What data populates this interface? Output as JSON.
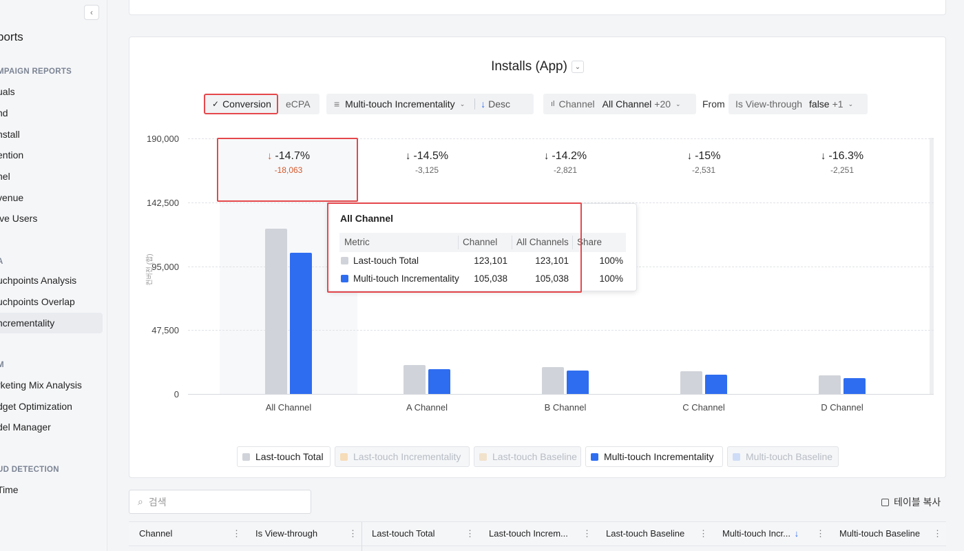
{
  "sidebar": {
    "collapse_icon": "‹",
    "title": "ports",
    "section1": "MPAIGN REPORTS",
    "items1": [
      "uals",
      "nd",
      "nstall",
      "ention",
      "nel",
      "venue",
      "ive Users"
    ],
    "section2": "A",
    "items2": [
      "uchpoints Analysis",
      "uchpoints Overlap",
      "ncrementality"
    ],
    "section3": "M",
    "items3": [
      "rketing Mix Analysis",
      "dget Optimization",
      "del Manager"
    ],
    "section4": "UD DETECTION",
    "items4": [
      "Time"
    ]
  },
  "chart": {
    "title": "Installs (App)",
    "title_dd_icon": "⌄",
    "seg_conversion": "Conversion",
    "seg_check": "✓",
    "seg_ecpa": "eCPA",
    "sort_icon": "≡",
    "sort_label": "Multi-touch Incrementality",
    "sort_arrow": "↓",
    "sort_desc": "Desc",
    "chevron": "⌄",
    "channel_icon": "ıl",
    "channel_label": "Channel",
    "channel_value": "All Channel",
    "channel_more": "+20",
    "from_label": "From",
    "ivt_label": "Is View-through",
    "ivt_value": "false",
    "ivt_more": "+1",
    "y_axis_label": "컨버전 (합)",
    "y_ticks": [
      "190,000",
      "142,500",
      "95,000",
      "47,500",
      "0"
    ]
  },
  "chart_data": {
    "type": "bar",
    "categories": [
      "All Channel",
      "A Channel",
      "B Channel",
      "C Channel",
      "D Channel"
    ],
    "series": [
      {
        "name": "Last-touch Total",
        "values": [
          123101,
          21500,
          20000,
          16800,
          14000
        ]
      },
      {
        "name": "Multi-touch Incrementality",
        "values": [
          105038,
          18375,
          17179,
          14269,
          11749
        ]
      }
    ],
    "deltas": [
      {
        "pct": "-14.7%",
        "abs": "-18,063"
      },
      {
        "pct": "-14.5%",
        "abs": "-3,125"
      },
      {
        "pct": "-14.2%",
        "abs": "-2,821"
      },
      {
        "pct": "-15%",
        "abs": "-2,531"
      },
      {
        "pct": "-16.3%",
        "abs": "-2,251"
      }
    ],
    "ylim": [
      0,
      190000
    ],
    "grid": true,
    "colors": {
      "Last-touch Total": "#d0d3d9",
      "Multi-touch Incrementality": "#2f6df0"
    }
  },
  "tooltip": {
    "title": "All Channel",
    "headers": [
      "Metric",
      "Channel",
      "All Channels",
      "Share"
    ],
    "rows": [
      {
        "metric": "Last-touch Total",
        "channel": "123,101",
        "all": "123,101",
        "share": "100%",
        "color": "#d0d3d9"
      },
      {
        "metric": "Multi-touch Incrementality",
        "channel": "105,038",
        "all": "105,038",
        "share": "100%",
        "color": "#2f6df0"
      }
    ]
  },
  "legend": [
    {
      "label": "Last-touch Total",
      "color": "#d0d3d9",
      "active": true
    },
    {
      "label": "Last-touch Incrementality",
      "color": "#f6dcb8",
      "active": false
    },
    {
      "label": "Last-touch Baseline",
      "color": "#f1e2cc",
      "active": false
    },
    {
      "label": "Multi-touch Incrementality",
      "color": "#2f6df0",
      "active": true
    },
    {
      "label": "Multi-touch Baseline",
      "color": "#cfdcf7",
      "active": false
    }
  ],
  "search": {
    "placeholder": "검색",
    "icon": "⌕"
  },
  "copy_label": "테이블 복사",
  "table": {
    "columns": [
      "Channel",
      "Is View-through",
      "Last-touch Total",
      "Last-touch Increm...",
      "Last-touch Baseline",
      "Multi-touch Incr...",
      "Multi-touch Baseline"
    ],
    "sort_icon": "↓",
    "menu_icon": "⋮"
  }
}
